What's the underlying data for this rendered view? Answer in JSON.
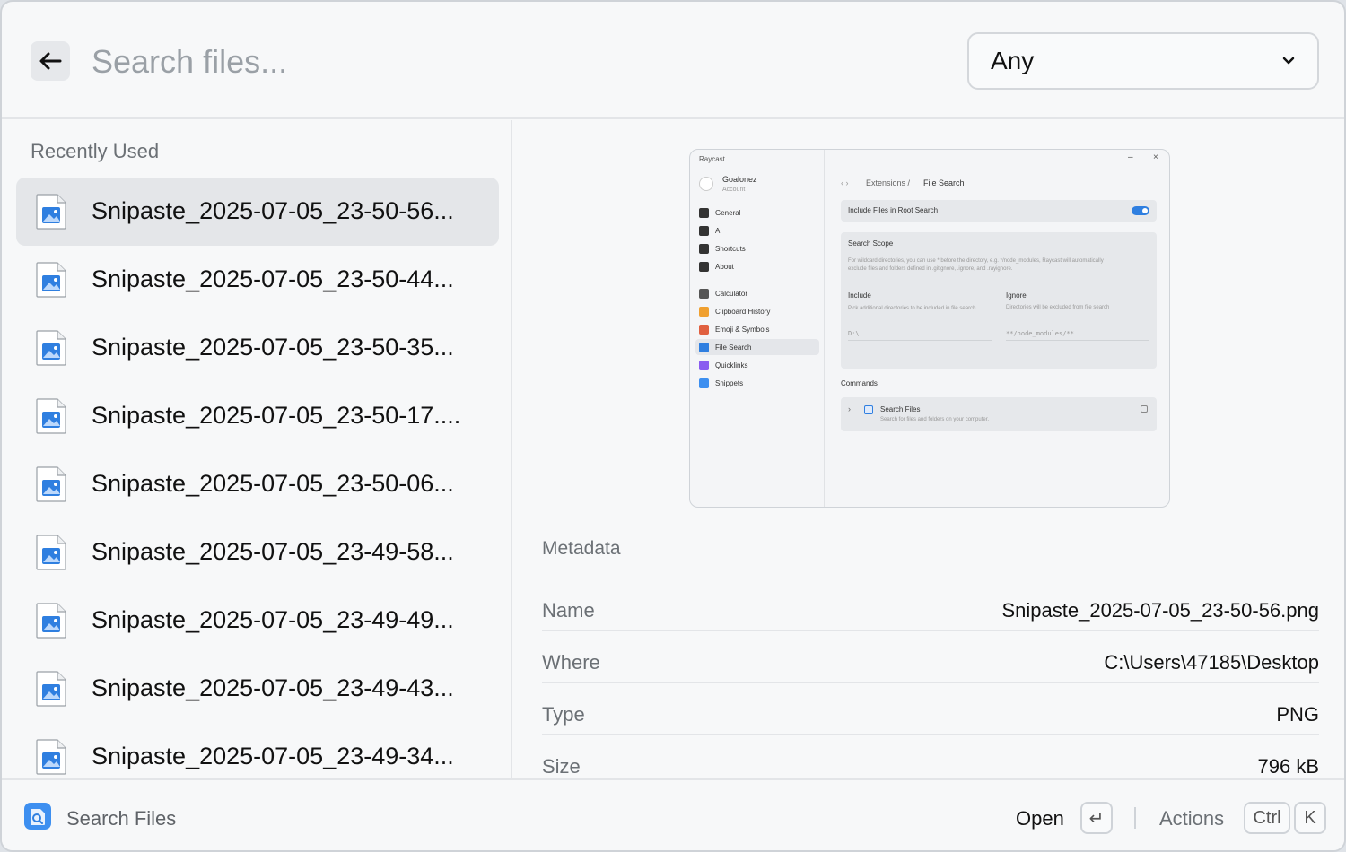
{
  "header": {
    "search_placeholder": "Search files...",
    "filter_value": "Any"
  },
  "list": {
    "section_title": "Recently Used",
    "items": [
      {
        "label": "Snipaste_2025-07-05_23-50-56...",
        "selected": true
      },
      {
        "label": "Snipaste_2025-07-05_23-50-44..."
      },
      {
        "label": "Snipaste_2025-07-05_23-50-35..."
      },
      {
        "label": "Snipaste_2025-07-05_23-50-17...."
      },
      {
        "label": "Snipaste_2025-07-05_23-50-06..."
      },
      {
        "label": "Snipaste_2025-07-05_23-49-58..."
      },
      {
        "label": "Snipaste_2025-07-05_23-49-49..."
      },
      {
        "label": "Snipaste_2025-07-05_23-49-43..."
      },
      {
        "label": "Snipaste_2025-07-05_23-49-34..."
      }
    ]
  },
  "preview": {
    "app_title": "Raycast",
    "user_name": "Goalonez",
    "user_sub": "Account",
    "nav": [
      "General",
      "AI",
      "Shortcuts",
      "About",
      "Calculator",
      "Clipboard History",
      "Emoji & Symbols",
      "File Search",
      "Quicklinks",
      "Snippets"
    ],
    "breadcrumb_parent": "Extensions /",
    "breadcrumb_current": "File Search",
    "toggle_label": "Include Files in Root Search",
    "scope_title": "Search Scope",
    "scope_desc": "For wildcard directories, you can use * before the directory, e.g. */node_modules, Raycast will automatically exclude files and folders defined in .gitignore, .ignore, and .rayignore.",
    "include_title": "Include",
    "include_desc": "Pick additional directories to be included in file search",
    "include_value": "D:\\",
    "ignore_title": "Ignore",
    "ignore_desc": "Directories will be excluded from file search",
    "ignore_value": "**/node_modules/**",
    "commands_title": "Commands",
    "command_name": "Search Files",
    "command_desc": "Search for files and folders on your computer."
  },
  "metadata": {
    "title": "Metadata",
    "rows": [
      {
        "key": "Name",
        "value": "Snipaste_2025-07-05_23-50-56.png"
      },
      {
        "key": "Where",
        "value": "C:\\Users\\47185\\Desktop"
      },
      {
        "key": "Type",
        "value": "PNG"
      },
      {
        "key": "Size",
        "value": "796 kB"
      }
    ]
  },
  "footer": {
    "title": "Search Files",
    "open_label": "Open",
    "open_key": "↵",
    "actions_label": "Actions",
    "actions_keys": [
      "Ctrl",
      "K"
    ]
  },
  "colors": {
    "accent": "#2f7fe0",
    "background": "#f7f8f9",
    "selected_row": "#e4e6e9"
  }
}
